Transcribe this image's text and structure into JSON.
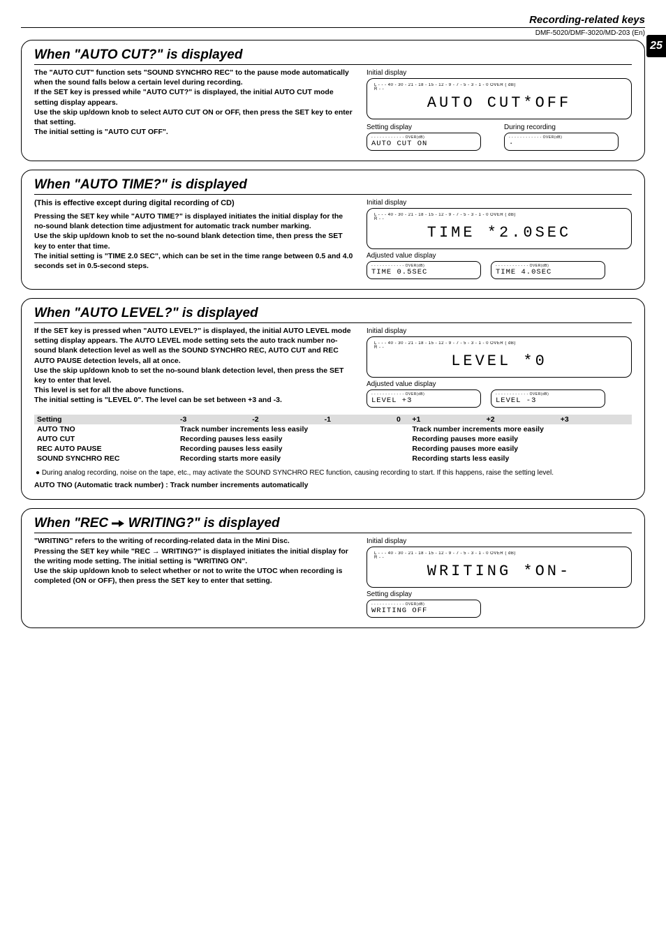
{
  "header": {
    "section_title": "Recording-related keys",
    "model_line": "DMF-5020/DMF-3020/MD-203 (En)",
    "page_number": "25"
  },
  "auto_cut": {
    "heading": "When \"AUTO CUT?\" is displayed",
    "para": "The \"AUTO CUT\" function sets \"SOUND SYNCHRO REC\" to the pause mode automatically when the sound falls below a certain level during recording.\nIf the SET key is pressed while \"AUTO CUT?\" is displayed, the initial AUTO CUT mode setting display appears.\nUse the skip up/down knob to select AUTO CUT ON or OFF, then press the SET key to enter that setting.\nThe initial setting is \"AUTO CUT   OFF\".",
    "cap_initial": "Initial display",
    "lcd_initial": "AUTO CUT*OFF",
    "cap_setting": "Setting display",
    "lcd_setting": "AUTO CUT  ON",
    "cap_during": "During recording",
    "lcd_during": "·"
  },
  "auto_time": {
    "heading": "When \"AUTO TIME?\" is displayed",
    "subnote": "(This is effective except during digital recording of CD)",
    "para": "Pressing the SET key while \"AUTO TIME?\" is displayed initiates the initial display for the no-sound blank detection time adjustment for automatic track number marking.\nUse the skip up/down knob to set the no-sound blank detection time, then press the SET key to enter that time.\nThe initial setting is \"TIME   2.0 SEC\", which can be set in the time range between 0.5 and 4.0 seconds set in 0.5-second steps.",
    "cap_initial": "Initial display",
    "lcd_initial": "TIME *2.0SEC",
    "cap_adjusted": "Adjusted value display",
    "lcd_adj_a": "TIME  0.5SEC",
    "lcd_adj_b": "TIME  4.0SEC"
  },
  "auto_level": {
    "heading": "When \"AUTO LEVEL?\" is displayed",
    "para": "If the SET key is pressed when \"AUTO LEVEL?\" is displayed, the initial AUTO LEVEL mode setting display appears.  The AUTO LEVEL mode setting sets the auto track number no-sound blank detection level as well as the SOUND SYNCHRO REC, AUTO CUT and REC AUTO PAUSE detection levels, all at once.\nUse the skip up/down knob to set the no-sound blank detection level, then press the SET key to enter that level.\nThis level is set for all the above functions.\nThe initial setting is \"LEVEL   0\".  The level can be set between +3 and -3.",
    "cap_initial": "Initial display",
    "lcd_initial": "LEVEL    *0",
    "cap_adjusted": "Adjusted value display",
    "lcd_adj_a": "LEVEL  +3",
    "lcd_adj_b": "LEVEL  -3",
    "table": {
      "header": [
        "Setting",
        "-3",
        "-2",
        "-1",
        "0",
        "+1",
        "+2",
        "+3"
      ],
      "rows": [
        [
          "AUTO TNO",
          "Track number increments less easily",
          "Track number increments more easily"
        ],
        [
          "AUTO CUT",
          "Recording pauses less easily",
          "Recording pauses more easily"
        ],
        [
          "REC AUTO PAUSE",
          "Recording pauses less easily",
          "Recording pauses more easily"
        ],
        [
          "SOUND SYNCHRO REC",
          "Recording starts more easily",
          "Recording starts less easily"
        ]
      ]
    },
    "note": "During analog recording, noise on the tape, etc., may activate the SOUND SYNCHRO REC function, causing recording to start.  If this happens, raise the setting level.",
    "auto_tno_note": "AUTO TNO (Automatic track number) : Track number increments automatically"
  },
  "rec_writing": {
    "heading_prefix": "When \"REC ",
    "heading_suffix": " WRITING?\" is displayed",
    "para": "\"WRITING\" refers to the writing of recording-related data in the Mini Disc.\nPressing the SET key while \"REC → WRITING?\" is displayed initiates the initial display for the writing mode setting. The initial setting is \"WRITING   ON\".\nUse the skip up/down knob to select whether or not to write the UTOC when recording is completed (ON or OFF), then press the SET key to enter that setting.",
    "cap_initial": "Initial display",
    "lcd_initial": "WRITING   *ON-",
    "cap_setting": "Setting display",
    "lcd_setting": "WRITING  OFF"
  },
  "meter": "L - - - 40 - 30 - 21 - 18 - 15 - 12 - 9 - 7 - 5 - 3 - 1 - 0 OVER ( dB)\nR - -"
}
